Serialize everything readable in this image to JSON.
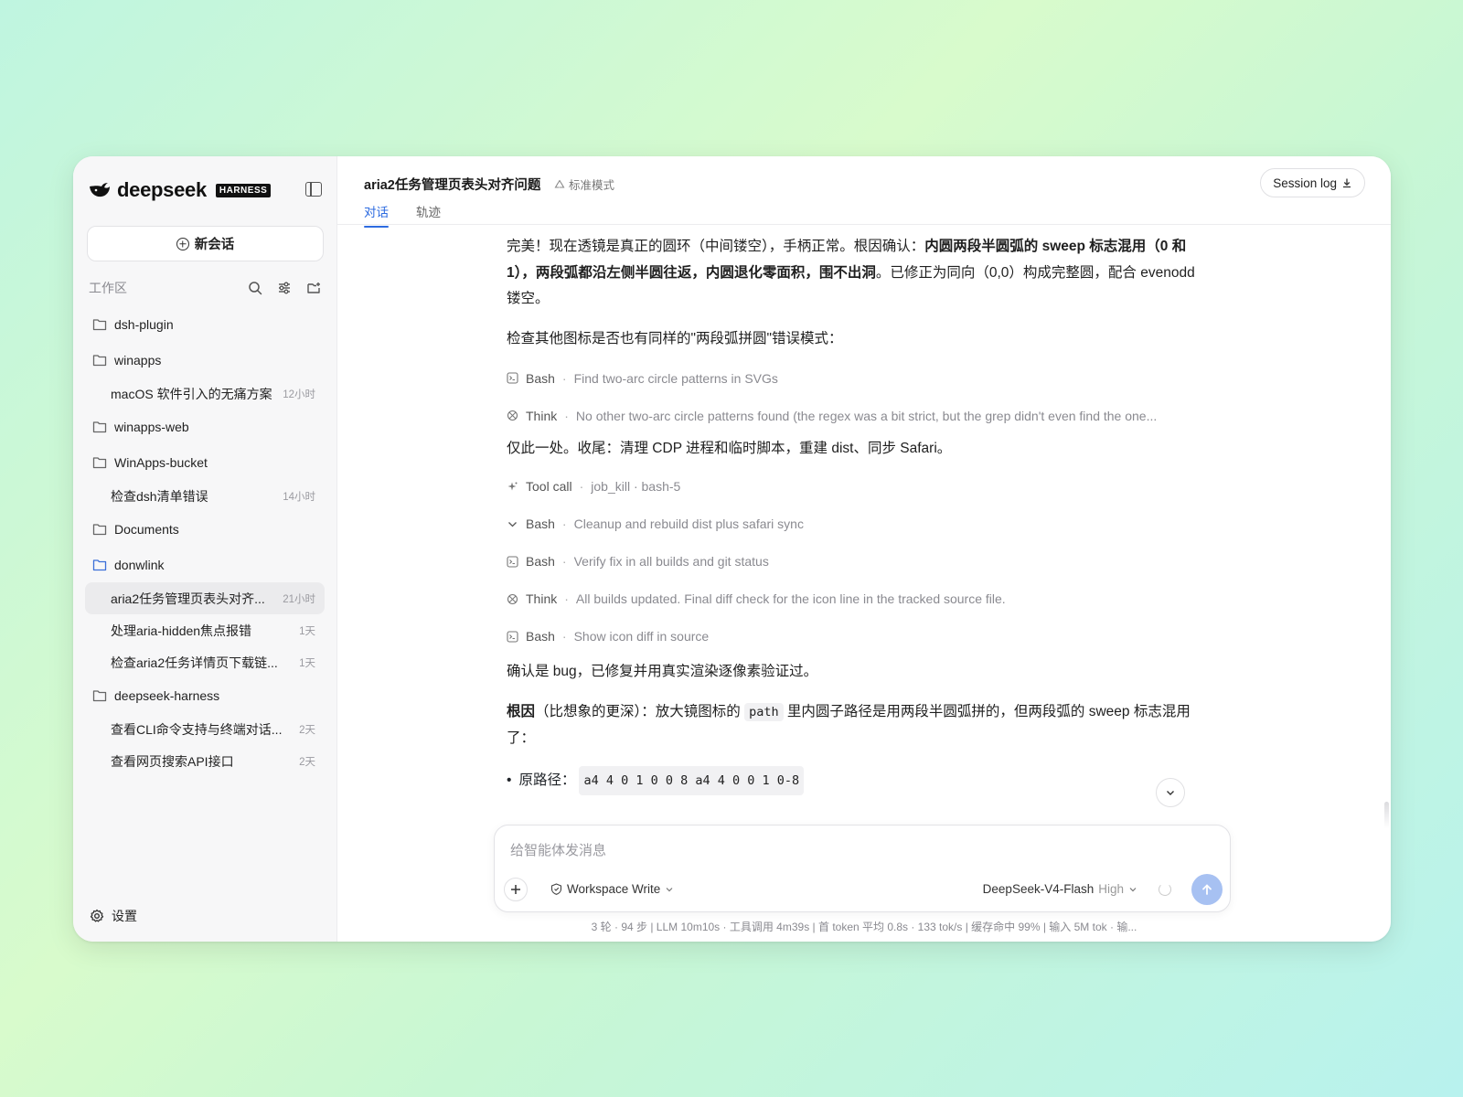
{
  "brand": {
    "name": "deepseek",
    "badge": "HARNESS"
  },
  "sidebar": {
    "new_chat_label": "新会话",
    "workspace_label": "工作区",
    "tree": [
      {
        "type": "folder",
        "label": "dsh-plugin"
      },
      {
        "type": "folder",
        "label": "winapps"
      },
      {
        "type": "session",
        "label": "macOS 软件引入的无痛方案",
        "time": "12小时"
      },
      {
        "type": "folder",
        "label": "winapps-web"
      },
      {
        "type": "folder",
        "label": "WinApps-bucket"
      },
      {
        "type": "session",
        "label": "检查dsh清单错误",
        "time": "14小时"
      },
      {
        "type": "folder",
        "label": "Documents"
      },
      {
        "type": "folder",
        "label": "donwlink",
        "open": true
      },
      {
        "type": "session",
        "label": "aria2任务管理页表头对齐...",
        "time": "21小时",
        "active": true
      },
      {
        "type": "session",
        "label": "处理aria-hidden焦点报错",
        "time": "1天"
      },
      {
        "type": "session",
        "label": "检查aria2任务详情页下载链...",
        "time": "1天"
      },
      {
        "type": "folder",
        "label": "deepseek-harness"
      },
      {
        "type": "session",
        "label": "查看CLI命令支持与终端对话...",
        "time": "2天"
      },
      {
        "type": "session",
        "label": "查看网页搜索API接口",
        "time": "2天"
      }
    ],
    "settings_label": "设置"
  },
  "header": {
    "title": "aria2任务管理页表头对齐问题",
    "mode": "标准模式",
    "tabs": [
      "对话",
      "轨迹"
    ],
    "session_log": "Session log"
  },
  "messages": {
    "p1_a": "完美！现在透镜是真正的圆环（中间镂空），手柄正常。根因确认：",
    "p1_b": "内圆两段半圆弧的 sweep 标志混用（0 和 1），两段弧都沿左侧半圆往返，内圆退化零面积，围不出洞",
    "p1_c": "。已修正为同向（0,0）构成完整圆，配合 evenodd 镂空。",
    "p2": "检查其他图标是否也有同样的\"两段弧拼圆\"错误模式：",
    "tool1": {
      "name": "Bash",
      "desc": "Find two-arc circle patterns in SVGs"
    },
    "tool2": {
      "name": "Think",
      "desc": "No other two-arc circle patterns found (the regex was a bit strict, but the grep didn't even find the one..."
    },
    "p3": "仅此一处。收尾：清理 CDP 进程和临时脚本，重建 dist、同步 Safari。",
    "tool3": {
      "name": "Tool call",
      "desc": "job_kill · bash-5"
    },
    "tool4": {
      "name": "Bash",
      "desc": "Cleanup and rebuild dist plus safari sync"
    },
    "tool5": {
      "name": "Bash",
      "desc": "Verify fix in all builds and git status"
    },
    "tool6": {
      "name": "Think",
      "desc": "All builds updated. Final diff check for the icon line in the tracked source file."
    },
    "tool7": {
      "name": "Bash",
      "desc": "Show icon diff in source"
    },
    "p4": "确认是 bug，已修复并用真实渲染逐像素验证过。",
    "p5_bold": "根因",
    "p5_a": "（比想象的更深）：放大镜图标的",
    "p5_code": "path",
    "p5_b": "里内圆子路径是用两段半圆弧拼的，但两段弧的 sweep 标志混用了：",
    "bullet1_label": "原路径：",
    "bullet1_code": "a4 4 0 1 0 0 8 a4 4 0 0 1 0-8"
  },
  "composer": {
    "placeholder": "给智能体发消息",
    "permission": "Workspace Write",
    "model": "DeepSeek-V4-Flash",
    "level": "High"
  },
  "status": "3 轮 · 94 步  |  LLM 10m10s · 工具调用 4m39s  |  首 token 平均 0.8s · 133 tok/s  |  缓存命中 99%  |  输入 5M tok · 输..."
}
